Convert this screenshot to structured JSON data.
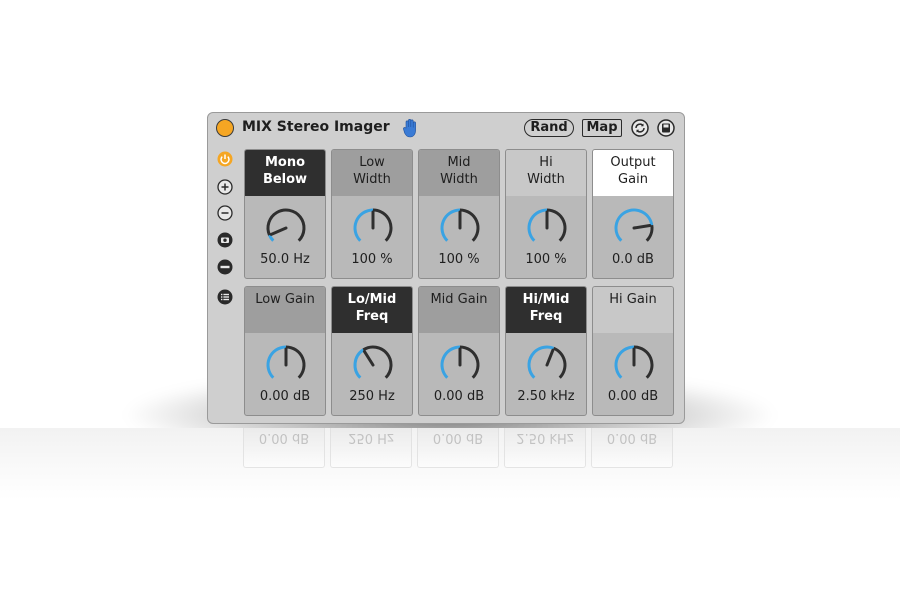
{
  "device": {
    "title": "MIX Stereo Imager",
    "power_color": "#f5a623",
    "accent_color": "#3aa3e3",
    "rand_label": "Rand",
    "map_label": "Map",
    "icons": [
      "power-icon",
      "hand-icon",
      "refresh-icon",
      "save-icon"
    ]
  },
  "sidebar": {
    "items": [
      "power-icon",
      "plus-icon",
      "minus-icon",
      "snapshot-icon",
      "collapse-icon",
      "list-icon"
    ]
  },
  "panels": [
    {
      "title": "Mono\nBelow",
      "value": "50.0 Hz",
      "style": "dark",
      "knob_fraction": 0.08
    },
    {
      "title": "Low\nWidth",
      "value": "100 %",
      "style": "mid",
      "knob_fraction": 0.5
    },
    {
      "title": "Mid\nWidth",
      "value": "100 %",
      "style": "mid",
      "knob_fraction": 0.5
    },
    {
      "title": "Hi\nWidth",
      "value": "100 %",
      "style": "light",
      "knob_fraction": 0.5
    },
    {
      "title": "Output\nGain",
      "value": "0.0 dB",
      "style": "white",
      "knob_fraction": 0.8
    },
    {
      "title": "Low Gain",
      "value": "0.00 dB",
      "style": "mid",
      "knob_fraction": 0.5
    },
    {
      "title": "Lo/Mid\nFreq",
      "value": "250 Hz",
      "style": "dark",
      "knob_fraction": 0.38
    },
    {
      "title": "Mid Gain",
      "value": "0.00 dB",
      "style": "mid",
      "knob_fraction": 0.5
    },
    {
      "title": "Hi/Mid\nFreq",
      "value": "2.50 kHz",
      "style": "dark",
      "knob_fraction": 0.58
    },
    {
      "title": "Hi Gain",
      "value": "0.00 dB",
      "style": "light",
      "knob_fraction": 0.5
    }
  ]
}
